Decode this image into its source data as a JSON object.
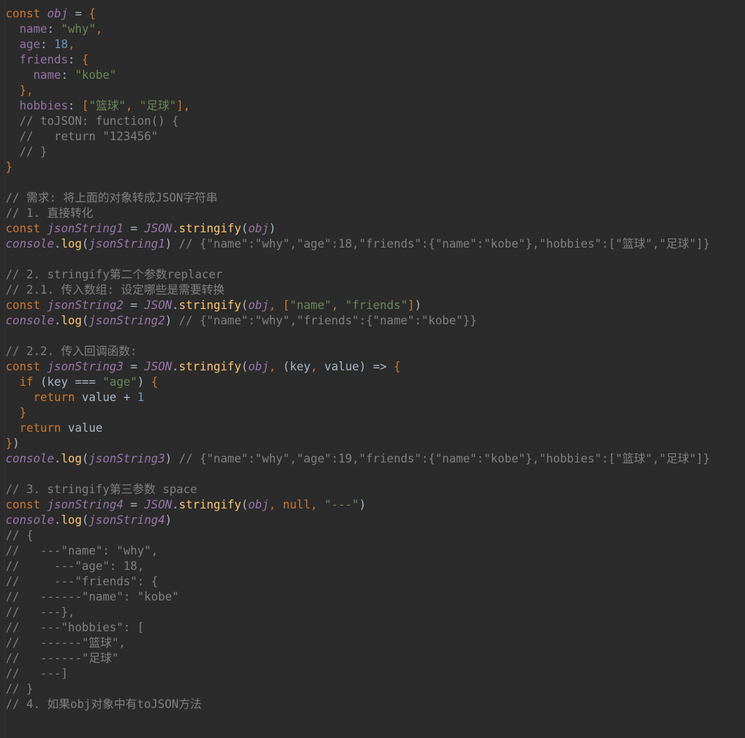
{
  "editor": {
    "background": "#2b2b2b",
    "default_text_color": "#a9b7c6",
    "colors": {
      "keyword": "#cc7832",
      "identifier": "#9876aa",
      "property": "#9373a5",
      "string": "#6a8759",
      "number": "#6897bb",
      "function": "#ffc66d",
      "comment": "#808080"
    },
    "language": "JavaScript",
    "line_height_px": 22,
    "font_size_px": 16.5
  },
  "code": {
    "lines": [
      {
        "n": 1,
        "tokens": [
          {
            "t": "keyword",
            "s": "const"
          },
          {
            "t": "plain",
            "s": " "
          },
          {
            "t": "ident",
            "s": "obj"
          },
          {
            "t": "plain",
            "s": " "
          },
          {
            "t": "op",
            "s": "="
          },
          {
            "t": "plain",
            "s": " "
          },
          {
            "t": "brace",
            "s": "{"
          }
        ]
      },
      {
        "n": 2,
        "tokens": [
          {
            "t": "plain",
            "s": "  "
          },
          {
            "t": "prop",
            "s": "name"
          },
          {
            "t": "punct",
            "s": ":"
          },
          {
            "t": "plain",
            "s": " "
          },
          {
            "t": "string",
            "s": "\"why\""
          },
          {
            "t": "comma",
            "s": ","
          }
        ]
      },
      {
        "n": 3,
        "tokens": [
          {
            "t": "plain",
            "s": "  "
          },
          {
            "t": "prop",
            "s": "age"
          },
          {
            "t": "punct",
            "s": ":"
          },
          {
            "t": "plain",
            "s": " "
          },
          {
            "t": "number",
            "s": "18"
          },
          {
            "t": "comma",
            "s": ","
          }
        ]
      },
      {
        "n": 4,
        "tokens": [
          {
            "t": "plain",
            "s": "  "
          },
          {
            "t": "prop",
            "s": "friends"
          },
          {
            "t": "punct",
            "s": ":"
          },
          {
            "t": "plain",
            "s": " "
          },
          {
            "t": "brace",
            "s": "{"
          }
        ]
      },
      {
        "n": 5,
        "tokens": [
          {
            "t": "plain",
            "s": "    "
          },
          {
            "t": "prop",
            "s": "name"
          },
          {
            "t": "punct",
            "s": ":"
          },
          {
            "t": "plain",
            "s": " "
          },
          {
            "t": "string",
            "s": "\"kobe\""
          }
        ]
      },
      {
        "n": 6,
        "tokens": [
          {
            "t": "plain",
            "s": "  "
          },
          {
            "t": "brace",
            "s": "}"
          },
          {
            "t": "comma",
            "s": ","
          }
        ]
      },
      {
        "n": 7,
        "tokens": [
          {
            "t": "plain",
            "s": "  "
          },
          {
            "t": "prop",
            "s": "hobbies"
          },
          {
            "t": "punct",
            "s": ":"
          },
          {
            "t": "plain",
            "s": " "
          },
          {
            "t": "brace",
            "s": "["
          },
          {
            "t": "string",
            "s": "\"篮球\""
          },
          {
            "t": "comma",
            "s": ","
          },
          {
            "t": "plain",
            "s": " "
          },
          {
            "t": "string",
            "s": "\"足球\""
          },
          {
            "t": "brace",
            "s": "]"
          },
          {
            "t": "comma",
            "s": ","
          }
        ]
      },
      {
        "n": 8,
        "tokens": [
          {
            "t": "plain",
            "s": "  "
          },
          {
            "t": "comment",
            "s": "// toJSON: function() {"
          }
        ]
      },
      {
        "n": 9,
        "tokens": [
          {
            "t": "plain",
            "s": "  "
          },
          {
            "t": "comment",
            "s": "//   return \"123456\""
          }
        ]
      },
      {
        "n": 10,
        "tokens": [
          {
            "t": "plain",
            "s": "  "
          },
          {
            "t": "comment",
            "s": "// }"
          }
        ]
      },
      {
        "n": 11,
        "tokens": [
          {
            "t": "brace",
            "s": "}"
          }
        ]
      },
      {
        "n": 12,
        "tokens": []
      },
      {
        "n": 13,
        "tokens": [
          {
            "t": "comment",
            "s": "// 需求: 将上面的对象转成JSON字符串"
          }
        ]
      },
      {
        "n": 14,
        "tokens": [
          {
            "t": "comment",
            "s": "// 1. 直接转化"
          }
        ]
      },
      {
        "n": 15,
        "tokens": [
          {
            "t": "keyword",
            "s": "const"
          },
          {
            "t": "plain",
            "s": " "
          },
          {
            "t": "ident",
            "s": "jsonString1"
          },
          {
            "t": "plain",
            "s": " "
          },
          {
            "t": "op",
            "s": "="
          },
          {
            "t": "plain",
            "s": " "
          },
          {
            "t": "ident",
            "s": "JSON"
          },
          {
            "t": "punct",
            "s": "."
          },
          {
            "t": "func",
            "s": "stringify"
          },
          {
            "t": "punct",
            "s": "("
          },
          {
            "t": "ident",
            "s": "obj"
          },
          {
            "t": "punct",
            "s": ")"
          }
        ]
      },
      {
        "n": 16,
        "tokens": [
          {
            "t": "ident",
            "s": "console"
          },
          {
            "t": "punct",
            "s": "."
          },
          {
            "t": "func",
            "s": "log"
          },
          {
            "t": "punct",
            "s": "("
          },
          {
            "t": "ident",
            "s": "jsonString1"
          },
          {
            "t": "punct",
            "s": ")"
          },
          {
            "t": "plain",
            "s": " "
          },
          {
            "t": "comment",
            "s": "// {\"name\":\"why\",\"age\":18,\"friends\":{\"name\":\"kobe\"},\"hobbies\":[\"篮球\",\"足球\"]}"
          }
        ]
      },
      {
        "n": 17,
        "tokens": []
      },
      {
        "n": 18,
        "tokens": [
          {
            "t": "comment",
            "s": "// 2. stringify第二个参数replacer"
          }
        ]
      },
      {
        "n": 19,
        "tokens": [
          {
            "t": "comment",
            "s": "// 2.1. 传入数组: 设定哪些是需要转换"
          }
        ]
      },
      {
        "n": 20,
        "tokens": [
          {
            "t": "keyword",
            "s": "const"
          },
          {
            "t": "plain",
            "s": " "
          },
          {
            "t": "ident",
            "s": "jsonString2"
          },
          {
            "t": "plain",
            "s": " "
          },
          {
            "t": "op",
            "s": "="
          },
          {
            "t": "plain",
            "s": " "
          },
          {
            "t": "ident",
            "s": "JSON"
          },
          {
            "t": "punct",
            "s": "."
          },
          {
            "t": "func",
            "s": "stringify"
          },
          {
            "t": "punct",
            "s": "("
          },
          {
            "t": "ident",
            "s": "obj"
          },
          {
            "t": "comma",
            "s": ","
          },
          {
            "t": "plain",
            "s": " "
          },
          {
            "t": "brace",
            "s": "["
          },
          {
            "t": "string",
            "s": "\"name\""
          },
          {
            "t": "comma",
            "s": ","
          },
          {
            "t": "plain",
            "s": " "
          },
          {
            "t": "string",
            "s": "\"friends\""
          },
          {
            "t": "brace",
            "s": "]"
          },
          {
            "t": "punct",
            "s": ")"
          }
        ]
      },
      {
        "n": 21,
        "tokens": [
          {
            "t": "ident",
            "s": "console"
          },
          {
            "t": "punct",
            "s": "."
          },
          {
            "t": "func",
            "s": "log"
          },
          {
            "t": "punct",
            "s": "("
          },
          {
            "t": "ident",
            "s": "jsonString2"
          },
          {
            "t": "punct",
            "s": ")"
          },
          {
            "t": "plain",
            "s": " "
          },
          {
            "t": "comment",
            "s": "// {\"name\":\"why\",\"friends\":{\"name\":\"kobe\"}}"
          }
        ]
      },
      {
        "n": 22,
        "tokens": []
      },
      {
        "n": 23,
        "tokens": [
          {
            "t": "comment",
            "s": "// 2.2. 传入回调函数:"
          }
        ]
      },
      {
        "n": 24,
        "tokens": [
          {
            "t": "keyword",
            "s": "const"
          },
          {
            "t": "plain",
            "s": " "
          },
          {
            "t": "ident",
            "s": "jsonString3"
          },
          {
            "t": "plain",
            "s": " "
          },
          {
            "t": "op",
            "s": "="
          },
          {
            "t": "plain",
            "s": " "
          },
          {
            "t": "ident",
            "s": "JSON"
          },
          {
            "t": "punct",
            "s": "."
          },
          {
            "t": "func",
            "s": "stringify"
          },
          {
            "t": "punct",
            "s": "("
          },
          {
            "t": "ident",
            "s": "obj"
          },
          {
            "t": "comma",
            "s": ","
          },
          {
            "t": "plain",
            "s": " ("
          },
          {
            "t": "param",
            "s": "key"
          },
          {
            "t": "comma",
            "s": ","
          },
          {
            "t": "plain",
            "s": " "
          },
          {
            "t": "param",
            "s": "value"
          },
          {
            "t": "plain",
            "s": ") "
          },
          {
            "t": "op",
            "s": "=>"
          },
          {
            "t": "plain",
            "s": " "
          },
          {
            "t": "brace",
            "s": "{"
          }
        ]
      },
      {
        "n": 25,
        "tokens": [
          {
            "t": "plain",
            "s": "  "
          },
          {
            "t": "keyword",
            "s": "if"
          },
          {
            "t": "plain",
            "s": " ("
          },
          {
            "t": "param",
            "s": "key"
          },
          {
            "t": "plain",
            "s": " "
          },
          {
            "t": "op",
            "s": "==="
          },
          {
            "t": "plain",
            "s": " "
          },
          {
            "t": "string",
            "s": "\"age\""
          },
          {
            "t": "plain",
            "s": ") "
          },
          {
            "t": "brace",
            "s": "{"
          }
        ]
      },
      {
        "n": 26,
        "tokens": [
          {
            "t": "plain",
            "s": "    "
          },
          {
            "t": "keyword",
            "s": "return"
          },
          {
            "t": "plain",
            "s": " "
          },
          {
            "t": "param",
            "s": "value"
          },
          {
            "t": "plain",
            "s": " "
          },
          {
            "t": "op",
            "s": "+"
          },
          {
            "t": "plain",
            "s": " "
          },
          {
            "t": "number",
            "s": "1"
          }
        ]
      },
      {
        "n": 27,
        "tokens": [
          {
            "t": "plain",
            "s": "  "
          },
          {
            "t": "brace",
            "s": "}"
          }
        ]
      },
      {
        "n": 28,
        "tokens": [
          {
            "t": "plain",
            "s": "  "
          },
          {
            "t": "keyword",
            "s": "return"
          },
          {
            "t": "plain",
            "s": " "
          },
          {
            "t": "param",
            "s": "value"
          }
        ]
      },
      {
        "n": 29,
        "tokens": [
          {
            "t": "brace",
            "s": "}"
          },
          {
            "t": "punct",
            "s": ")"
          }
        ]
      },
      {
        "n": 30,
        "tokens": [
          {
            "t": "ident",
            "s": "console"
          },
          {
            "t": "punct",
            "s": "."
          },
          {
            "t": "func",
            "s": "log"
          },
          {
            "t": "punct",
            "s": "("
          },
          {
            "t": "ident",
            "s": "jsonString3"
          },
          {
            "t": "punct",
            "s": ")"
          },
          {
            "t": "plain",
            "s": " "
          },
          {
            "t": "comment",
            "s": "// {\"name\":\"why\",\"age\":19,\"friends\":{\"name\":\"kobe\"},\"hobbies\":[\"篮球\",\"足球\"]}"
          }
        ]
      },
      {
        "n": 31,
        "tokens": []
      },
      {
        "n": 32,
        "tokens": [
          {
            "t": "comment",
            "s": "// 3. stringify第三参数 space"
          }
        ]
      },
      {
        "n": 33,
        "tokens": [
          {
            "t": "keyword",
            "s": "const"
          },
          {
            "t": "plain",
            "s": " "
          },
          {
            "t": "ident",
            "s": "jsonString4"
          },
          {
            "t": "plain",
            "s": " "
          },
          {
            "t": "op",
            "s": "="
          },
          {
            "t": "plain",
            "s": " "
          },
          {
            "t": "ident",
            "s": "JSON"
          },
          {
            "t": "punct",
            "s": "."
          },
          {
            "t": "func",
            "s": "stringify"
          },
          {
            "t": "punct",
            "s": "("
          },
          {
            "t": "ident",
            "s": "obj"
          },
          {
            "t": "comma",
            "s": ","
          },
          {
            "t": "plain",
            "s": " "
          },
          {
            "t": "keyword",
            "s": "null"
          },
          {
            "t": "comma",
            "s": ","
          },
          {
            "t": "plain",
            "s": " "
          },
          {
            "t": "string",
            "s": "\"---\""
          },
          {
            "t": "punct",
            "s": ")"
          }
        ]
      },
      {
        "n": 34,
        "tokens": [
          {
            "t": "ident",
            "s": "console"
          },
          {
            "t": "punct",
            "s": "."
          },
          {
            "t": "func",
            "s": "log"
          },
          {
            "t": "punct",
            "s": "("
          },
          {
            "t": "ident",
            "s": "jsonString4"
          },
          {
            "t": "punct",
            "s": ")"
          }
        ]
      },
      {
        "n": 35,
        "tokens": [
          {
            "t": "comment",
            "s": "// {"
          }
        ]
      },
      {
        "n": 36,
        "tokens": [
          {
            "t": "comment",
            "s": "//   ---\"name\": \"why\","
          }
        ]
      },
      {
        "n": 37,
        "tokens": [
          {
            "t": "comment",
            "s": "//     ---\"age\": 18,"
          }
        ]
      },
      {
        "n": 38,
        "tokens": [
          {
            "t": "comment",
            "s": "//     ---\"friends\": {"
          }
        ]
      },
      {
        "n": 39,
        "tokens": [
          {
            "t": "comment",
            "s": "//   ------\"name\": \"kobe\""
          }
        ]
      },
      {
        "n": 40,
        "tokens": [
          {
            "t": "comment",
            "s": "//   ---},"
          }
        ]
      },
      {
        "n": 41,
        "tokens": [
          {
            "t": "comment",
            "s": "//   ---\"hobbies\": ["
          }
        ]
      },
      {
        "n": 42,
        "tokens": [
          {
            "t": "comment",
            "s": "//   ------\"篮球\","
          }
        ]
      },
      {
        "n": 43,
        "tokens": [
          {
            "t": "comment",
            "s": "//   ------\"足球\""
          }
        ]
      },
      {
        "n": 44,
        "tokens": [
          {
            "t": "comment",
            "s": "//   ---]"
          }
        ]
      },
      {
        "n": 45,
        "tokens": [
          {
            "t": "comment",
            "s": "// }"
          }
        ]
      },
      {
        "n": 46,
        "tokens": [
          {
            "t": "comment",
            "s": "// 4. 如果obj对象中有toJSON方法"
          }
        ]
      },
      {
        "n": 47,
        "tokens": []
      }
    ]
  }
}
